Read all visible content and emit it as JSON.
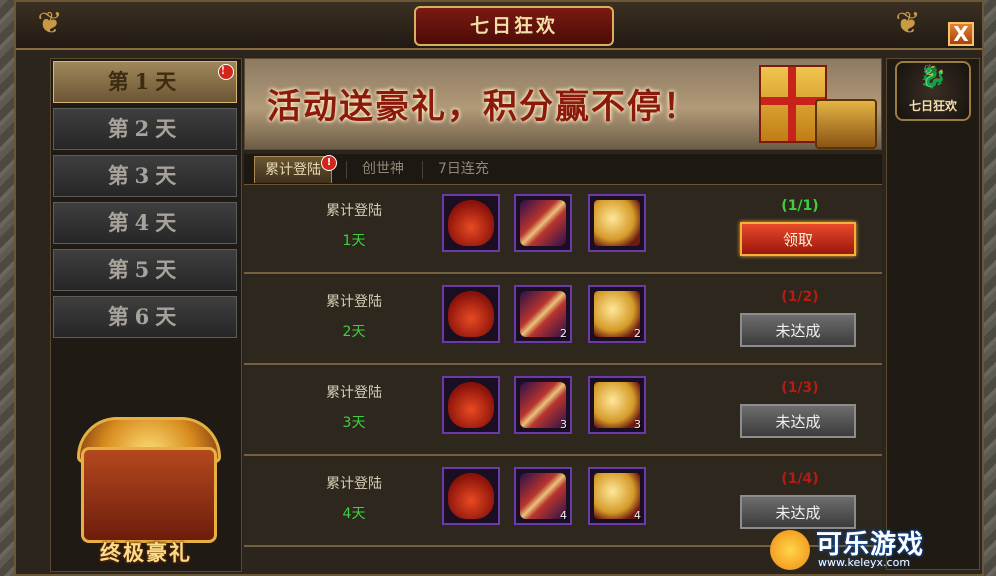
{
  "window": {
    "title": "七日狂欢",
    "close_label": "X"
  },
  "sidebar": {
    "days": [
      {
        "label": "第1天",
        "active": true,
        "alert": "!"
      },
      {
        "label": "第2天",
        "active": false
      },
      {
        "label": "第3天",
        "active": false
      },
      {
        "label": "第4天",
        "active": false
      },
      {
        "label": "第5天",
        "active": false
      },
      {
        "label": "第6天",
        "active": false
      }
    ],
    "final_reward_label": "终极豪礼"
  },
  "banner": {
    "slogan": "活动送豪礼，积分赢不停！"
  },
  "emblem": {
    "label": "七日狂欢"
  },
  "tabs": [
    {
      "label": "累计登陆",
      "active": true,
      "alert": "!"
    },
    {
      "label": "创世神",
      "active": false
    },
    {
      "label": "7日连充",
      "active": false
    }
  ],
  "rows": [
    {
      "title": "累计登陆",
      "days": "1天",
      "items": [
        {
          "icon": "red-pouch-icon",
          "count": ""
        },
        {
          "icon": "seal-token-icon",
          "count": ""
        },
        {
          "icon": "gold-chest-icon",
          "count": ""
        }
      ],
      "progress": "(1/1)",
      "complete": true,
      "button": "领取"
    },
    {
      "title": "累计登陆",
      "days": "2天",
      "items": [
        {
          "icon": "red-pouch-icon",
          "count": ""
        },
        {
          "icon": "seal-token-icon",
          "count": "2"
        },
        {
          "icon": "gold-chest-icon",
          "count": "2"
        }
      ],
      "progress": "(1/2)",
      "complete": false,
      "button": "未达成"
    },
    {
      "title": "累计登陆",
      "days": "3天",
      "items": [
        {
          "icon": "red-pouch-icon",
          "count": ""
        },
        {
          "icon": "seal-token-icon",
          "count": "3"
        },
        {
          "icon": "gold-chest-icon",
          "count": "3"
        }
      ],
      "progress": "(1/3)",
      "complete": false,
      "button": "未达成"
    },
    {
      "title": "累计登陆",
      "days": "4天",
      "items": [
        {
          "icon": "red-pouch-icon",
          "count": ""
        },
        {
          "icon": "seal-token-icon",
          "count": "4"
        },
        {
          "icon": "gold-chest-icon",
          "count": "4"
        }
      ],
      "progress": "(1/4)",
      "complete": false,
      "button": "未达成"
    }
  ],
  "watermark": {
    "brand": "可乐游戏",
    "url": "www.keleyx.com"
  },
  "colors": {
    "progress_complete": "#3dd13d",
    "progress_incomplete": "#b51c12",
    "day_count": "#3dd13d"
  }
}
